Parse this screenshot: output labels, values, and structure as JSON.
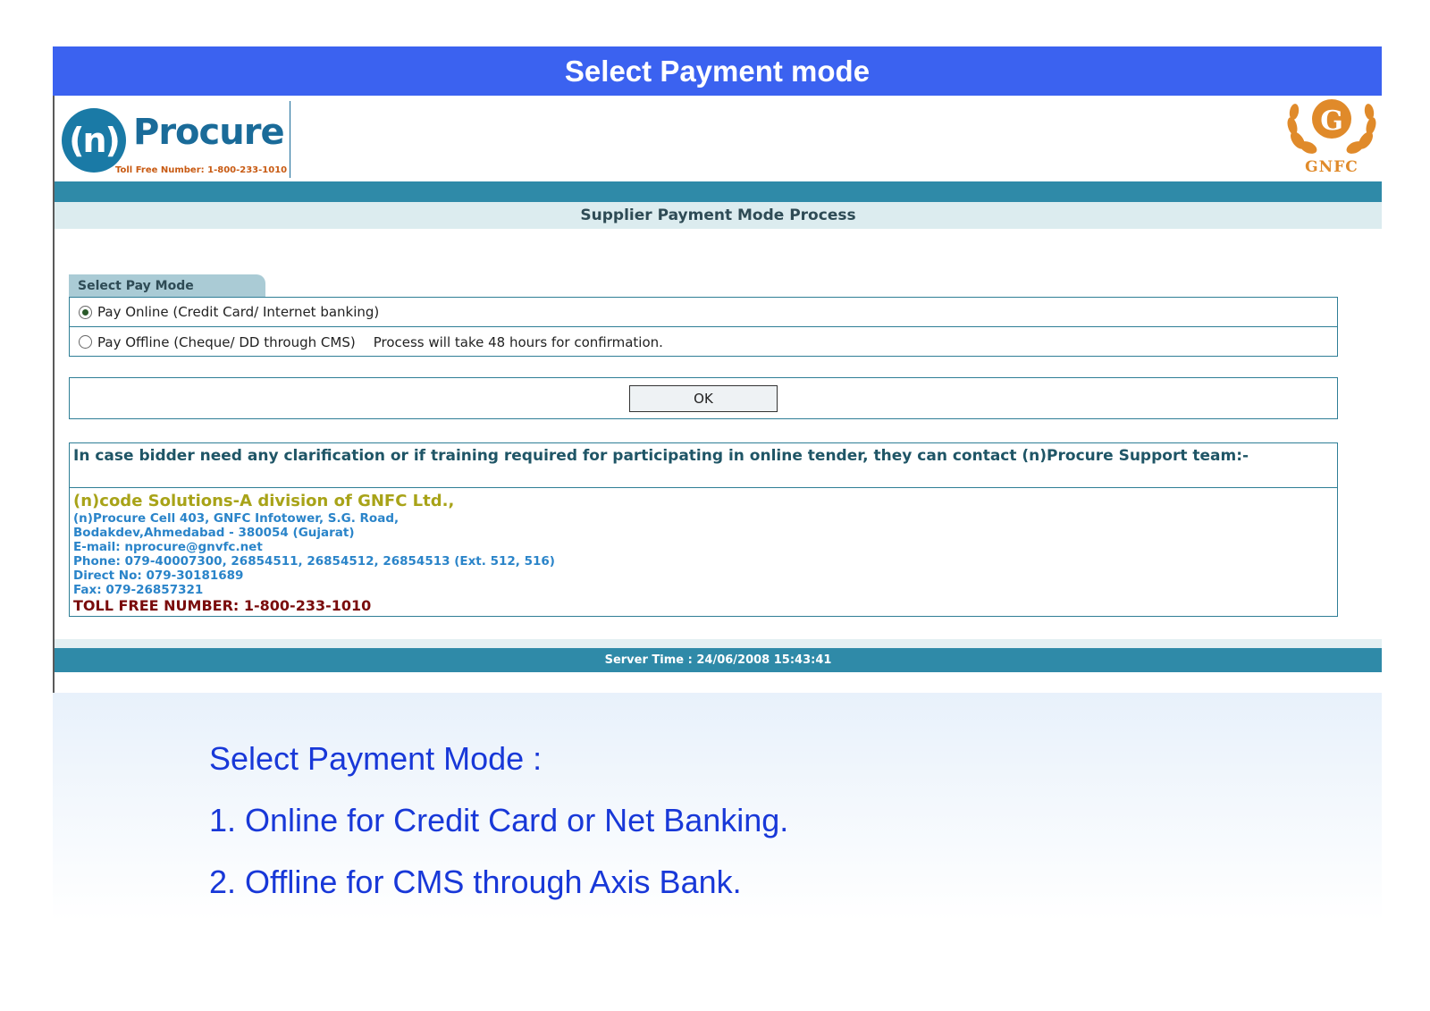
{
  "slide": {
    "title": "Select Payment mode",
    "bullets": [
      "Select Payment Mode :",
      "1.  Online for Credit Card or Net Banking.",
      "2.  Offline for CMS through Axis Bank."
    ]
  },
  "header": {
    "logo_circle": "(n)",
    "logo_word": "Procure",
    "toll_free_small": "Toll Free Number: 1-800-233-1010",
    "gnfc_letter": "G",
    "gnfc_text": "GNFC"
  },
  "page": {
    "subtitle": "Supplier Payment Mode Process",
    "tab_label": "Select Pay Mode",
    "options": [
      {
        "label": "Pay Online (Credit Card/ Internet banking)",
        "selected": true,
        "note": ""
      },
      {
        "label": "Pay Offline (Cheque/ DD through CMS)",
        "selected": false,
        "note": "Process will take 48 hours for confirmation."
      }
    ],
    "ok_label": "OK"
  },
  "contact": {
    "intro": "In case bidder need any clarification or if training required for participating in online tender, they can contact (n)Procure Support team:-",
    "org": "(n)code Solutions-A division of GNFC Ltd.,",
    "lines": [
      "(n)Procure Cell 403, GNFC Infotower, S.G. Road,",
      "Bodakdev,Ahmedabad - 380054 (Gujarat)",
      "E-mail: nprocure@gnvfc.net",
      "Phone: 079-40007300, 26854511, 26854512, 26854513 (Ext. 512, 516)",
      "Direct No: 079-30181689",
      "Fax: 079-26857321"
    ],
    "toll": "TOLL FREE NUMBER: 1-800-233-1010"
  },
  "footer": {
    "server_time": "Server Time : 24/06/2008 15:43:41"
  },
  "colors": {
    "title_bar": "#3b62f0",
    "teal": "#2f8aa8",
    "bullet_text": "#1838d8"
  }
}
